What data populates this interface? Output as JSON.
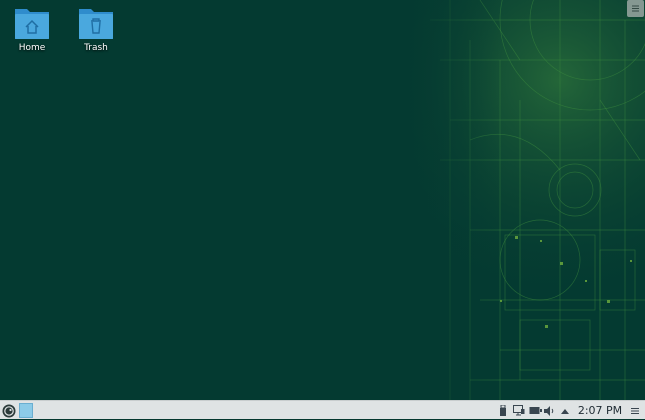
{
  "desktop": {
    "icons": [
      {
        "label": "Home",
        "icon": "home-folder-icon"
      },
      {
        "label": "Trash",
        "icon": "trash-folder-icon"
      }
    ]
  },
  "taskbar": {
    "clock": "2:07 PM",
    "tray_icons": [
      "usb-drive-icon",
      "network-icon",
      "battery-icon",
      "volume-icon",
      "expand-tray-arrow-icon",
      "panel-menu-icon"
    ]
  },
  "colors": {
    "desktop_bg": "#043a31",
    "wallpaper_lines": "#2f7b3c",
    "taskbar_bg": "#dfe3e4",
    "folder_blue": "#4aa8de"
  }
}
